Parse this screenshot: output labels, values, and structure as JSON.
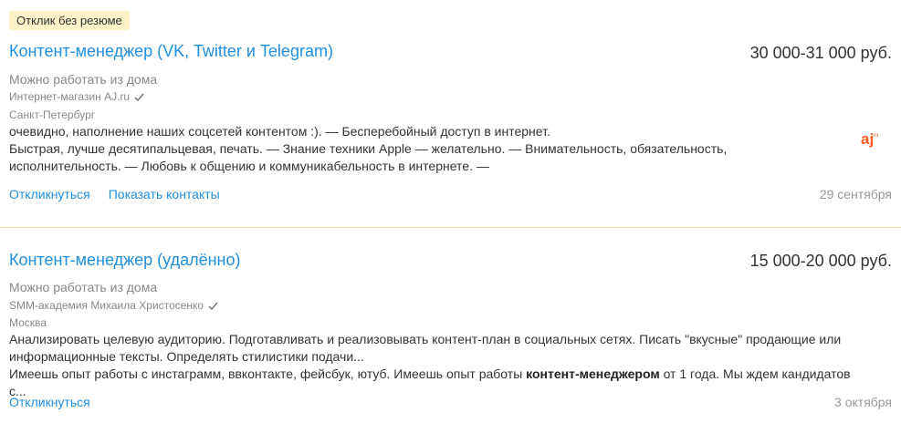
{
  "vacancies": [
    {
      "badge": "Отклик без резюме",
      "title": "Контент-менеджер (VK, Twitter и Telegram)",
      "salary": "30 000-31 000 руб.",
      "remote": "Можно работать из дома",
      "company": "Интернет-магазин AJ.ru",
      "city": "Санкт-Петербург",
      "desc_line1": "очевидно, наполнение наших соцсетей контентом :). — Бесперебойный доступ в интернет.",
      "desc_line2": "Быстрая, лучше десятипальцевая, печать. — Знание техники Apple — желательно. — Внимательность, обязательность, исполнительность. — Любовь к общению и коммуникабельность в интернете. —",
      "action_respond": "Откликнуться",
      "action_contacts": "Показать контакты",
      "date": "29 сентября",
      "logo_icon": "aj-ru-logo"
    },
    {
      "title": "Контент-менеджер (удалённо)",
      "salary": "15 000-20 000 руб.",
      "remote": "Можно работать из дома",
      "company": "SMM-академия Михаила Христосенко",
      "city": "Москва",
      "desc_line1": "Анализировать целевую аудиторию. Подготавливать и реализовывать контент-план в социальных сетях. Писать \"вкусные\" продающие или информационные тексты. Определять стилистики подачи...",
      "desc_line2_pre": "Имеешь опыт работы с инстаграмм, ввконтакте, фейсбук, ютуб. Имеешь опыт работы ",
      "desc_line2_bold": "контент-менеджером",
      "desc_line2_post": " от 1 года. Мы ждем кандидатов с...",
      "action_respond": "Откликнуться",
      "date": "3 октября"
    }
  ],
  "colors": {
    "link": "#1f8fdf",
    "badge_bg": "#fdf2c8",
    "divider": "#f4e3a8",
    "logo": "#ff5a1f"
  }
}
